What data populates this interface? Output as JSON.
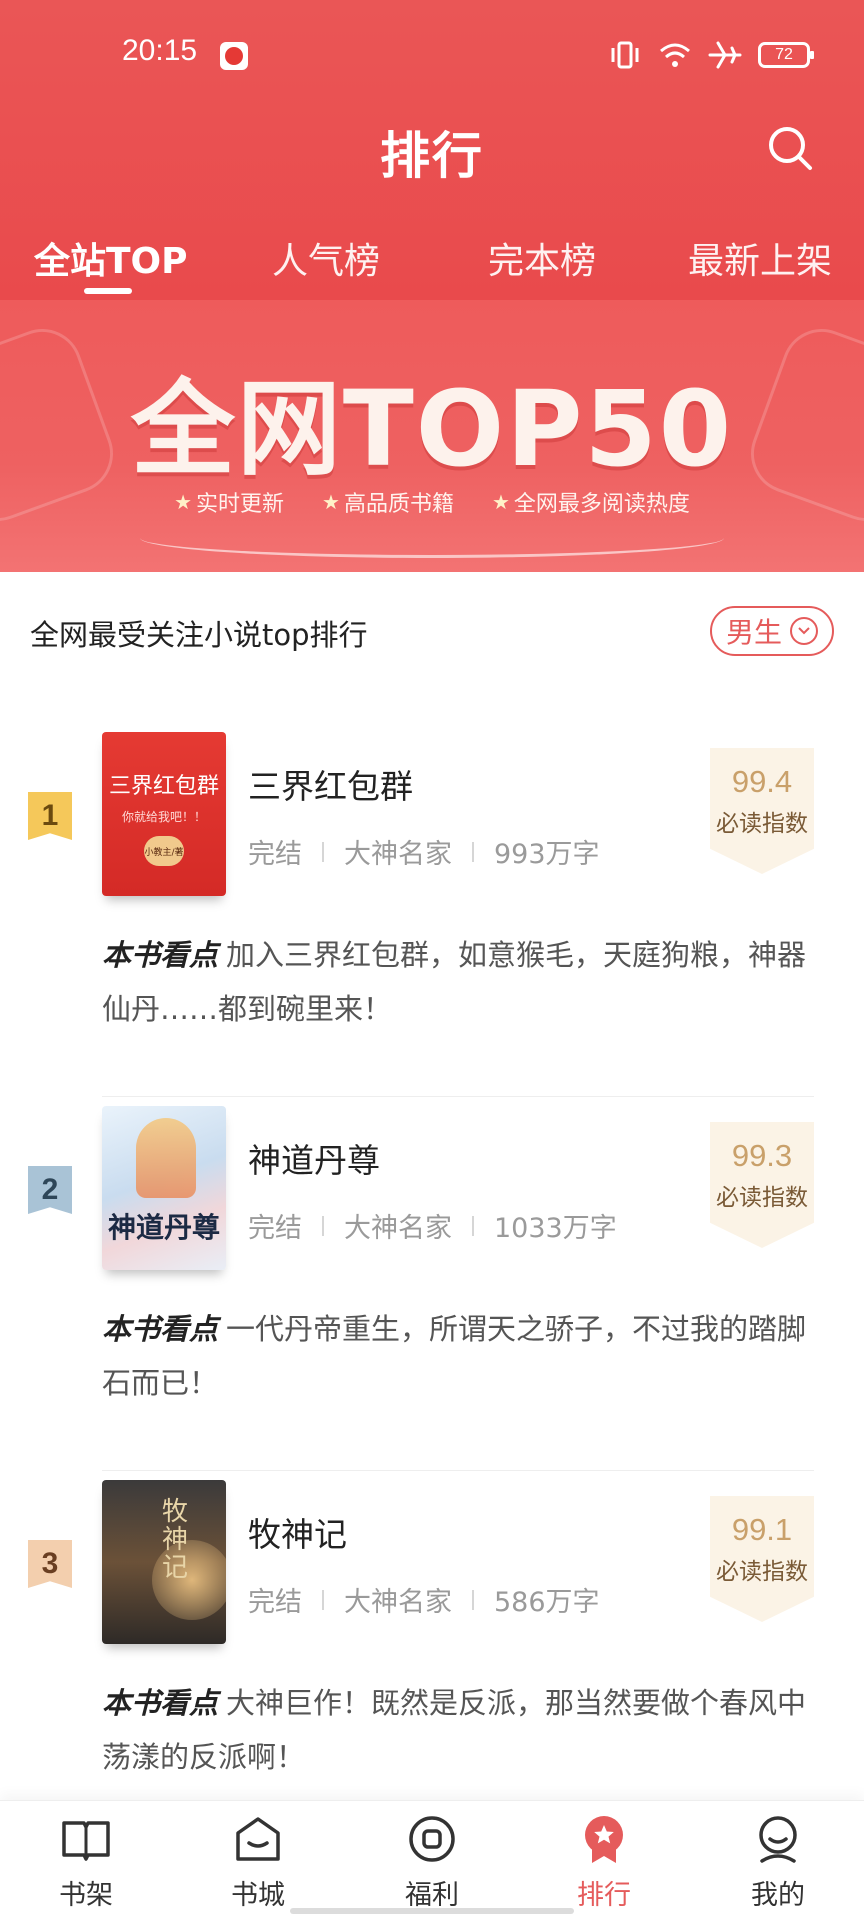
{
  "status_bar": {
    "time": "20:15",
    "battery": "72",
    "icons": [
      "video-app-icon",
      "vibrate-icon",
      "wifi-icon",
      "airplane-icon",
      "battery-icon"
    ]
  },
  "header": {
    "title": "排行",
    "search_icon": "search-icon"
  },
  "tabs": [
    {
      "label": "全站TOP",
      "active": true
    },
    {
      "label": "人气榜",
      "active": false
    },
    {
      "label": "完本榜",
      "active": false
    },
    {
      "label": "最新上架",
      "active": false
    }
  ],
  "banner": {
    "title": "全网TOP50",
    "features": [
      "实时更新",
      "高品质书籍",
      "全网最多阅读热度"
    ]
  },
  "section": {
    "title": "全网最受关注小说top排行",
    "gender_filter": "男生"
  },
  "books": [
    {
      "rank": "1",
      "title": "三界红包群",
      "status": "完结",
      "category": "大神名家",
      "words": "993万字",
      "score": "99.4",
      "score_label": "必读指数",
      "desc_label": "本书看点",
      "desc": "加入三界红包群，如意猴毛，天庭狗粮，神器仙丹……都到碗里来！",
      "cover_text": "三界红包群",
      "cover_sub": "你就给我吧！！",
      "cover_seal": "小教主/著"
    },
    {
      "rank": "2",
      "title": "神道丹尊",
      "status": "完结",
      "category": "大神名家",
      "words": "1033万字",
      "score": "99.3",
      "score_label": "必读指数",
      "desc_label": "本书看点",
      "desc": "一代丹帝重生，所谓天之骄子，不过我的踏脚石而已！",
      "cover_text": "神道丹尊"
    },
    {
      "rank": "3",
      "title": "牧神记",
      "status": "完结",
      "category": "大神名家",
      "words": "586万字",
      "score": "99.1",
      "score_label": "必读指数",
      "desc_label": "本书看点",
      "desc": "大神巨作！既然是反派，那当然要做个春风中荡漾的反派啊！",
      "cover_text": "牧神记"
    }
  ],
  "bottom_nav": [
    {
      "label": "书架",
      "icon": "bookshelf-icon",
      "active": false
    },
    {
      "label": "书城",
      "icon": "bookstore-icon",
      "active": false
    },
    {
      "label": "福利",
      "icon": "welfare-icon",
      "active": false
    },
    {
      "label": "排行",
      "icon": "ranking-icon",
      "active": true
    },
    {
      "label": "我的",
      "icon": "profile-icon",
      "active": false
    }
  ],
  "colors": {
    "brand_red": "#e94a4c",
    "accent_red": "#e55b5b",
    "score_gold": "#c9a06a"
  }
}
